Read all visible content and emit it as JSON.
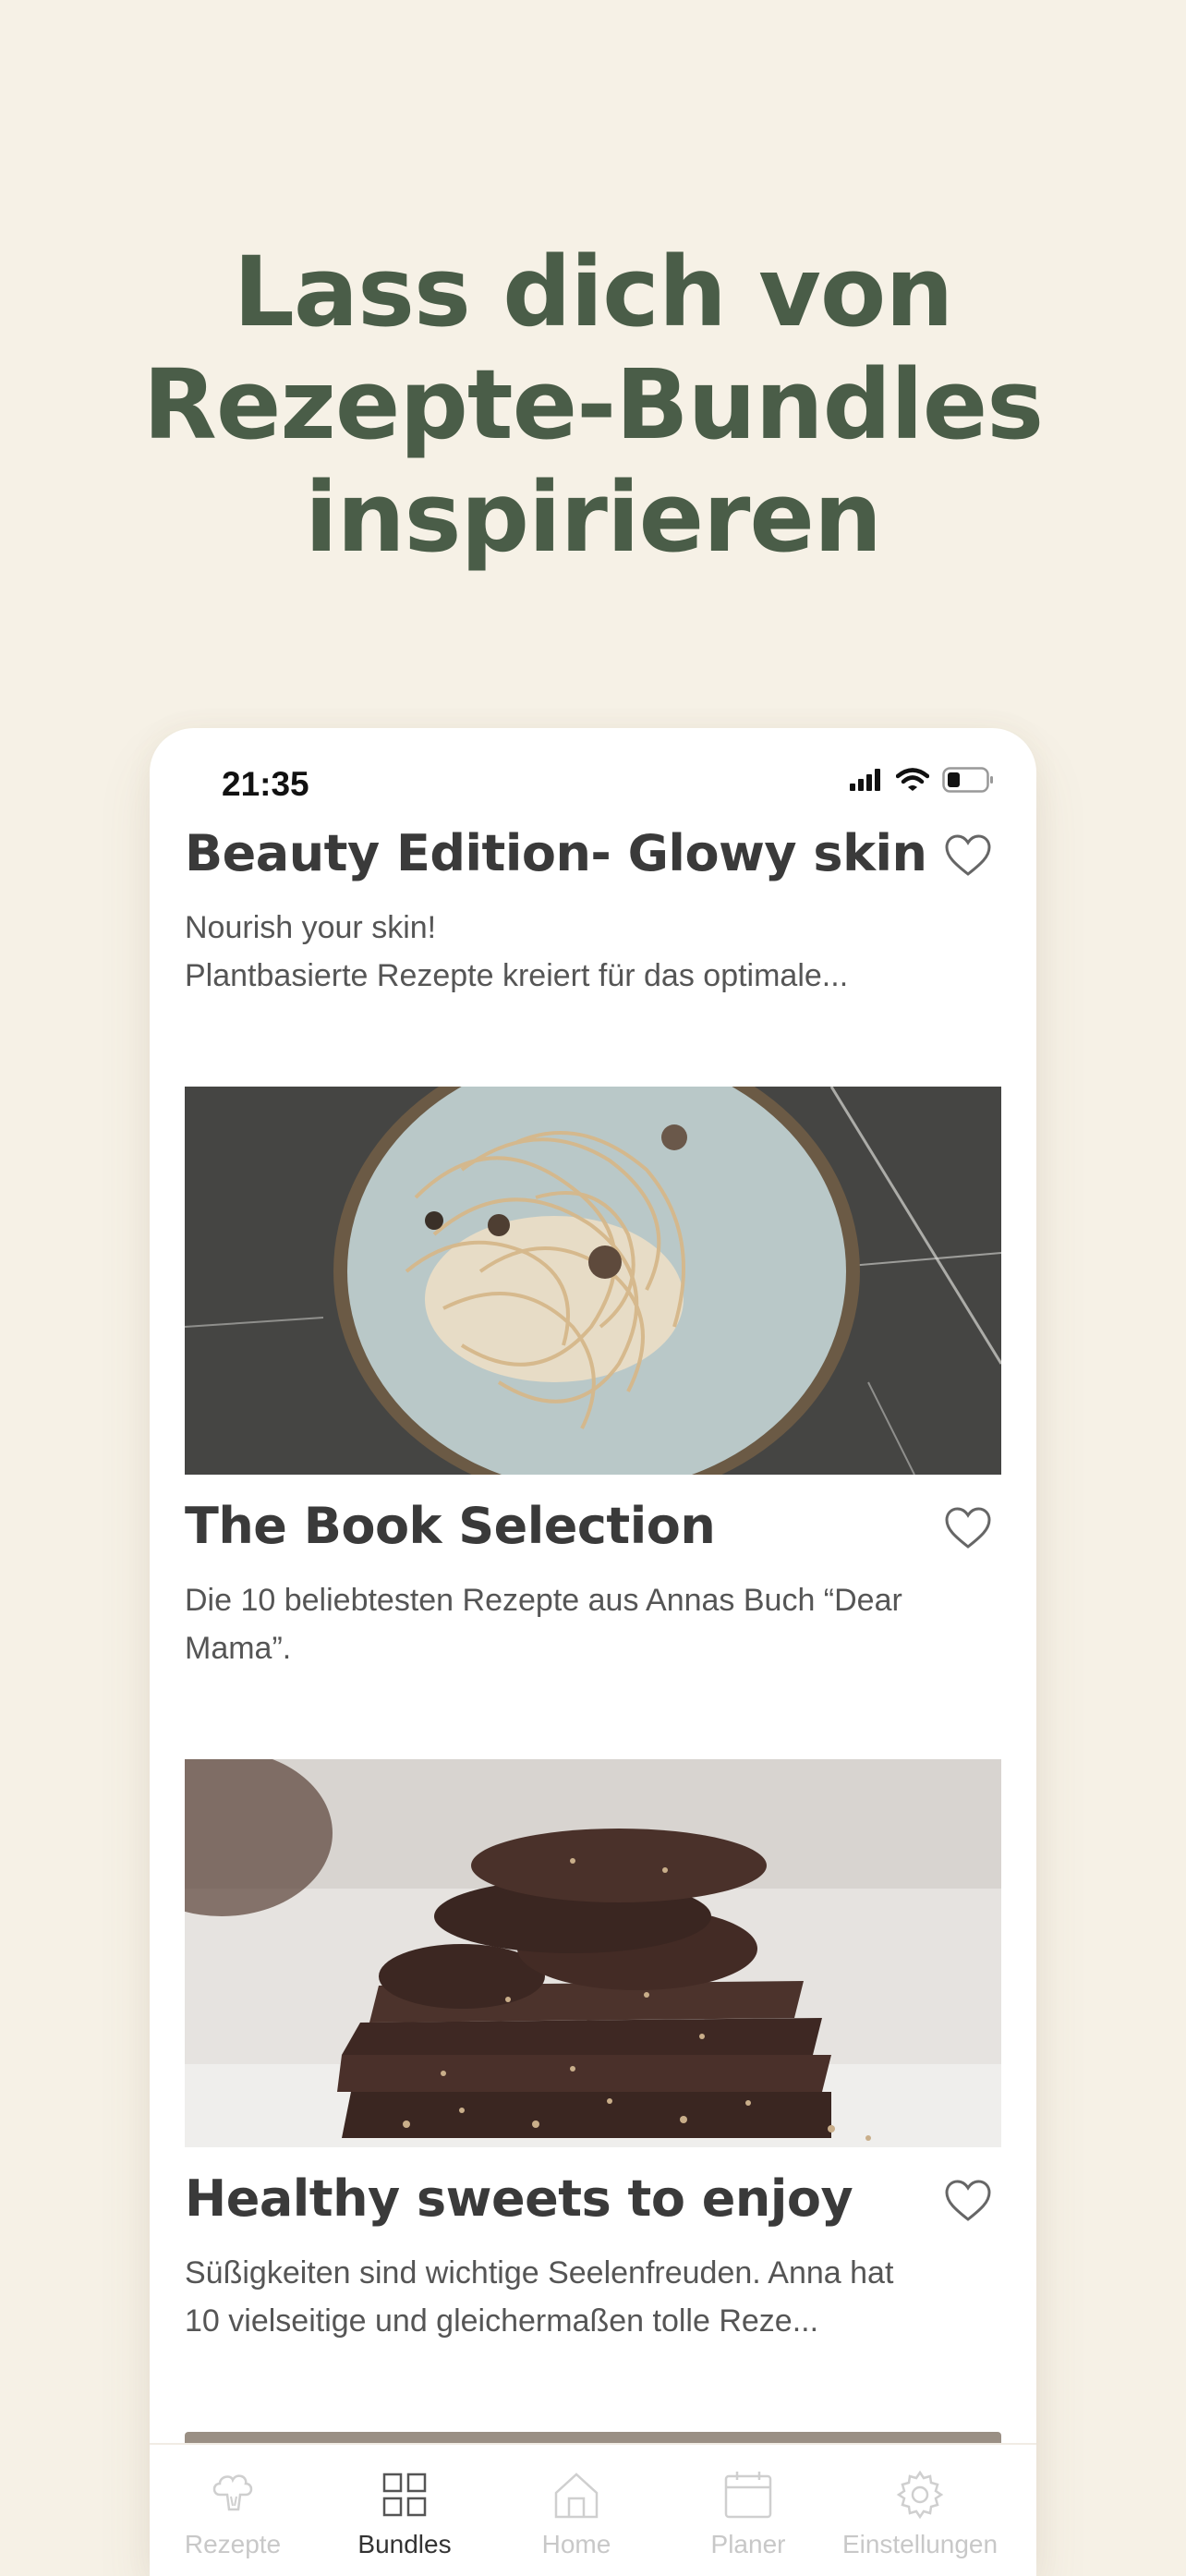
{
  "headline": [
    "Lass dich von",
    "Rezepte-Bundles",
    "inspirieren"
  ],
  "status_bar": {
    "time": "21:35"
  },
  "bundles": [
    {
      "title": "Beauty Edition- Glowy skin",
      "description": [
        "Nourish your skin!",
        "Plantbasierte Rezepte kreiert für das optimale..."
      ]
    },
    {
      "title": "The Book Selection",
      "description": [
        "Die 10 beliebtesten Rezepte aus Annas Buch “Dear",
        "Mama”."
      ]
    },
    {
      "title": "Healthy sweets to enjoy",
      "description": [
        "Süßigkeiten sind wichtige Seelenfreuden. Anna hat",
        "10 vielseitige und gleichermaßen tolle Reze..."
      ]
    }
  ],
  "tabs": [
    {
      "label": "Rezepte",
      "icon": "broccoli-icon",
      "active": false
    },
    {
      "label": "Bundles",
      "icon": "grid-icon",
      "active": true
    },
    {
      "label": "Home",
      "icon": "home-icon",
      "active": false
    },
    {
      "label": "Planer",
      "icon": "calendar-icon",
      "active": false
    },
    {
      "label": "Einstellungen",
      "icon": "gear-icon",
      "active": false
    }
  ],
  "colors": {
    "background": "#f6f1e6",
    "headline": "#4a5d48",
    "title": "#3a3a3a",
    "tab_inactive": "#c8c8c8",
    "tab_active": "#333333"
  }
}
